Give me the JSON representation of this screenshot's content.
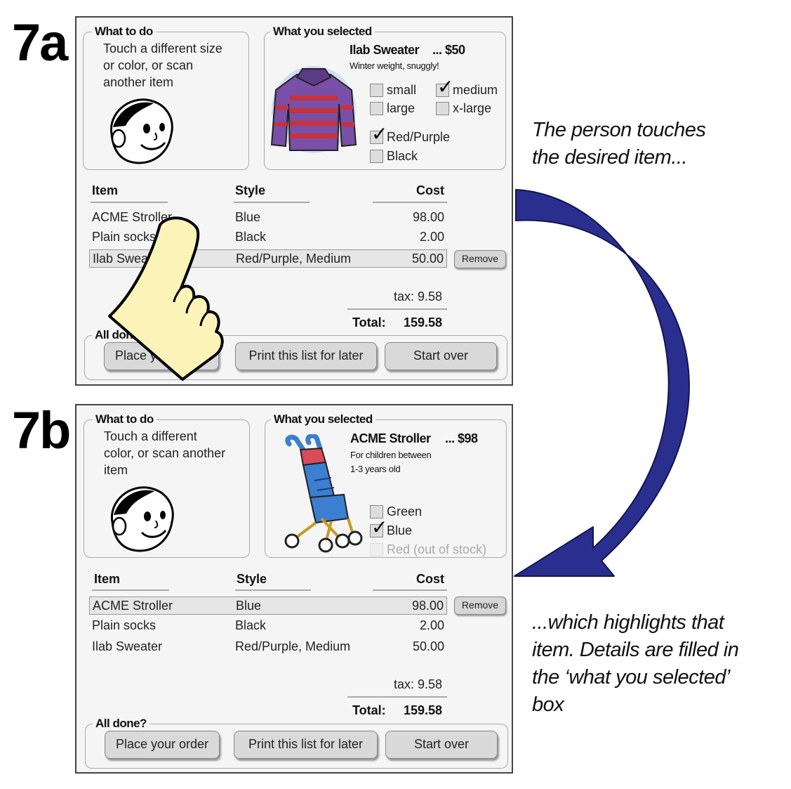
{
  "panel_a": {
    "label": "7a",
    "what_to_do": {
      "heading": "What to do",
      "lines": [
        "Touch a different size",
        "or color, or scan",
        "another item"
      ]
    },
    "what_selected": {
      "heading": "What you selected",
      "name": "Ilab Sweater",
      "price": "... $50",
      "desc_lines": [
        "Winter weight, snuggly!"
      ],
      "options": [
        {
          "label": "small",
          "checked": false
        },
        {
          "label": "medium",
          "checked": true
        },
        {
          "label": "large",
          "checked": false
        },
        {
          "label": "x-large",
          "checked": false
        },
        {
          "label": "Red/Purple",
          "checked": true
        },
        {
          "label": "Black",
          "checked": false
        }
      ]
    },
    "table": {
      "headers": [
        "Item",
        "Style",
        "Cost"
      ],
      "rows": [
        {
          "item": "ACME Stroller",
          "style": "Blue",
          "cost": "98.00"
        },
        {
          "item": "Plain socks",
          "style": "Black",
          "cost": "2.00"
        },
        {
          "item": "Ilab Sweater",
          "style": "Red/Purple, Medium",
          "cost": "50.00"
        }
      ],
      "selected_row": 2,
      "remove_label": "Remove",
      "tax": "tax: 9.58",
      "total_label": "Total:",
      "total_value": "159.58"
    },
    "all_done": {
      "heading": "All done?",
      "buttons": [
        "Place your order",
        "Print this list for later",
        "Start over"
      ]
    }
  },
  "panel_b": {
    "label": "7b",
    "what_to_do": {
      "heading": "What to do",
      "lines": [
        "Touch a different",
        "color, or scan another",
        "item"
      ]
    },
    "what_selected": {
      "heading": "What you selected",
      "name": "ACME Stroller",
      "price": "... $98",
      "desc_lines": [
        "For children between",
        "1-3 years old"
      ],
      "options": [
        {
          "label": "Green",
          "checked": false,
          "disabled": false
        },
        {
          "label": "Blue",
          "checked": true,
          "disabled": false
        },
        {
          "label": "Red (out of stock)",
          "checked": false,
          "disabled": true
        }
      ]
    },
    "table": {
      "headers": [
        "Item",
        "Style",
        "Cost"
      ],
      "rows": [
        {
          "item": "ACME Stroller",
          "style": "Blue",
          "cost": "98.00"
        },
        {
          "item": "Plain socks",
          "style": "Black",
          "cost": "2.00"
        },
        {
          "item": "Ilab Sweater",
          "style": "Red/Purple, Medium",
          "cost": "50.00"
        }
      ],
      "selected_row": 0,
      "remove_label": "Remove",
      "tax": "tax: 9.58",
      "total_label": "Total:",
      "total_value": "159.58"
    },
    "all_done": {
      "heading": "All done?",
      "buttons": [
        "Place your order",
        "Print this list for later",
        "Start over"
      ]
    }
  },
  "captions": {
    "top": [
      "The person touches",
      "the desired item..."
    ],
    "bottom": [
      "...which highlights that",
      "item. Details are filled in",
      "the ‘what  you selected’",
      "box"
    ]
  },
  "colors": {
    "arrow": "#2a2f8f",
    "hand": "#fbf3b8",
    "sweater_purple": "#7a4fa8",
    "sweater_red": "#c8323c",
    "stroller_blue": "#3c7ed0"
  }
}
